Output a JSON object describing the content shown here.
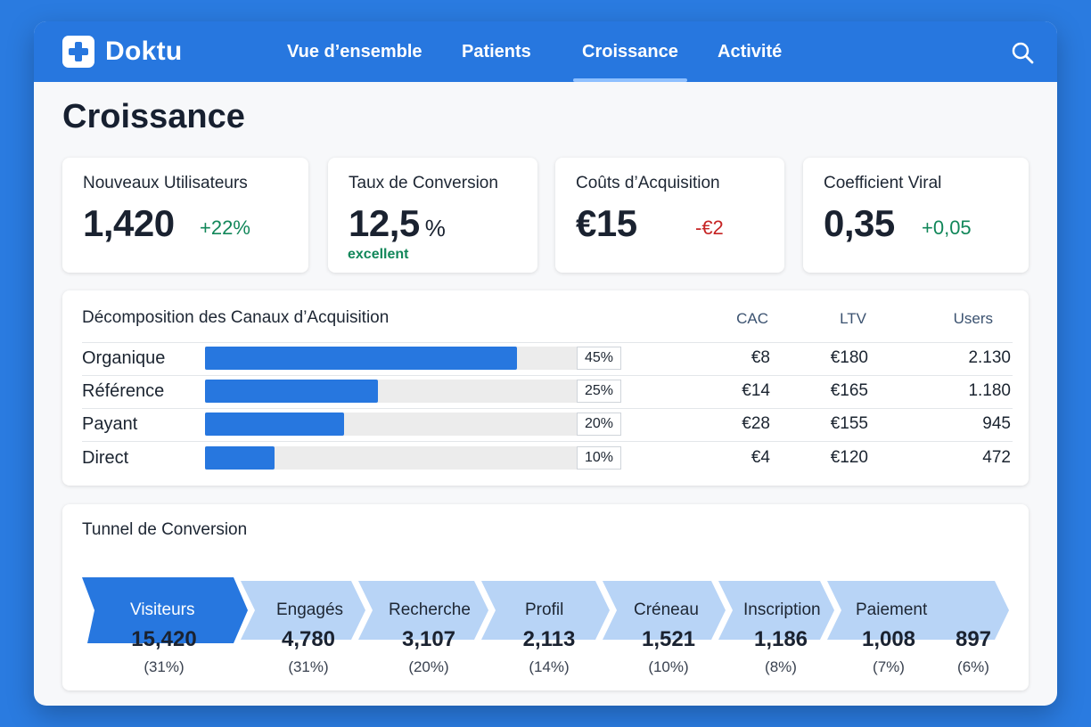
{
  "app": {
    "name": "Doktu"
  },
  "nav": {
    "items": [
      {
        "label": "Vue d’ensemble"
      },
      {
        "label": "Patients"
      },
      {
        "label": "Croissance",
        "active": true
      },
      {
        "label": "Activité"
      }
    ]
  },
  "page": {
    "title": "Croissance"
  },
  "kpis": [
    {
      "title": "Nouveaux Utilisateurs",
      "value": "1,420",
      "unit": "",
      "delta": "+22%",
      "delta_type": "positive",
      "note": ""
    },
    {
      "title": "Taux de Conversion",
      "value": "12,5",
      "unit": "%",
      "delta": "",
      "delta_type": "",
      "note": "excellent"
    },
    {
      "title": "Coûts d’Acquisition",
      "value": "€15",
      "unit": "",
      "delta": "-€2",
      "delta_type": "negative",
      "note": ""
    },
    {
      "title": "Coefficient Viral",
      "value": "0,35",
      "unit": "",
      "delta": "+0,05",
      "delta_type": "positive",
      "note": ""
    }
  ],
  "channels": {
    "title": "Décomposition des Canaux d’Acquisition",
    "columns": {
      "cac": "CAC",
      "ltv": "LTV",
      "users": "Users"
    },
    "rows": [
      {
        "name": "Organique",
        "share_pct": 45,
        "share_label": "45%",
        "cac": "€8",
        "ltv": "€180",
        "users": "2.130"
      },
      {
        "name": "Référence",
        "share_pct": 25,
        "share_label": "25%",
        "cac": "€14",
        "ltv": "€165",
        "users": "1.180"
      },
      {
        "name": "Payant",
        "share_pct": 20,
        "share_label": "20%",
        "cac": "€28",
        "ltv": "€155",
        "users": "945"
      },
      {
        "name": "Direct",
        "share_pct": 10,
        "share_label": "10%",
        "cac": "€4",
        "ltv": "€120",
        "users": "472"
      }
    ]
  },
  "funnel": {
    "title": "Tunnel de Conversion",
    "steps": [
      {
        "label": "Visiteurs",
        "value": "15,420",
        "pct": "(31%)",
        "active": true
      },
      {
        "label": "Engagés",
        "value": "4,780",
        "pct": "(31%)"
      },
      {
        "label": "Recherche",
        "value": "3,107",
        "pct": "(20%)"
      },
      {
        "label": "Profil",
        "value": "2,113",
        "pct": "(14%)"
      },
      {
        "label": "Créneau",
        "value": "1,521",
        "pct": "(10%)"
      },
      {
        "label": "Inscription",
        "value": "1,186",
        "pct": "(8%)"
      },
      {
        "label": "Paiement",
        "value": "1,008",
        "pct": "(7%)"
      }
    ],
    "final": {
      "value": "897",
      "pct": "(6%)"
    }
  },
  "colors": {
    "brand": "#2777df",
    "funnel_active": "#2777df",
    "funnel_inactive": "#b8d4f6",
    "positive": "#12875a",
    "negative": "#c62424"
  },
  "icons": {
    "logo": "medical-cross-icon",
    "search": "search-icon"
  }
}
